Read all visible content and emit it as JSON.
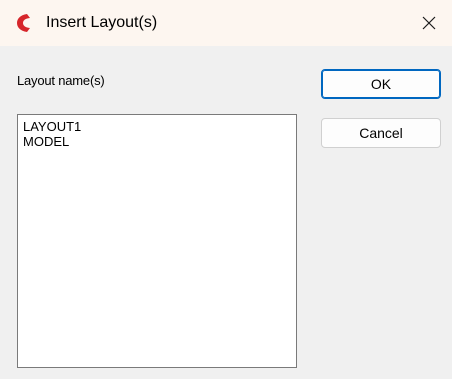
{
  "window": {
    "title": "Insert Layout(s)",
    "icon": "app-logo-icon",
    "close_icon": "close-icon"
  },
  "form": {
    "list_label": "Layout name(s)",
    "layouts": [
      "LAYOUT1",
      "MODEL"
    ]
  },
  "buttons": {
    "ok_label": "OK",
    "cancel_label": "Cancel"
  },
  "colors": {
    "accent": "#0067c0",
    "brand": "#d6262b"
  }
}
